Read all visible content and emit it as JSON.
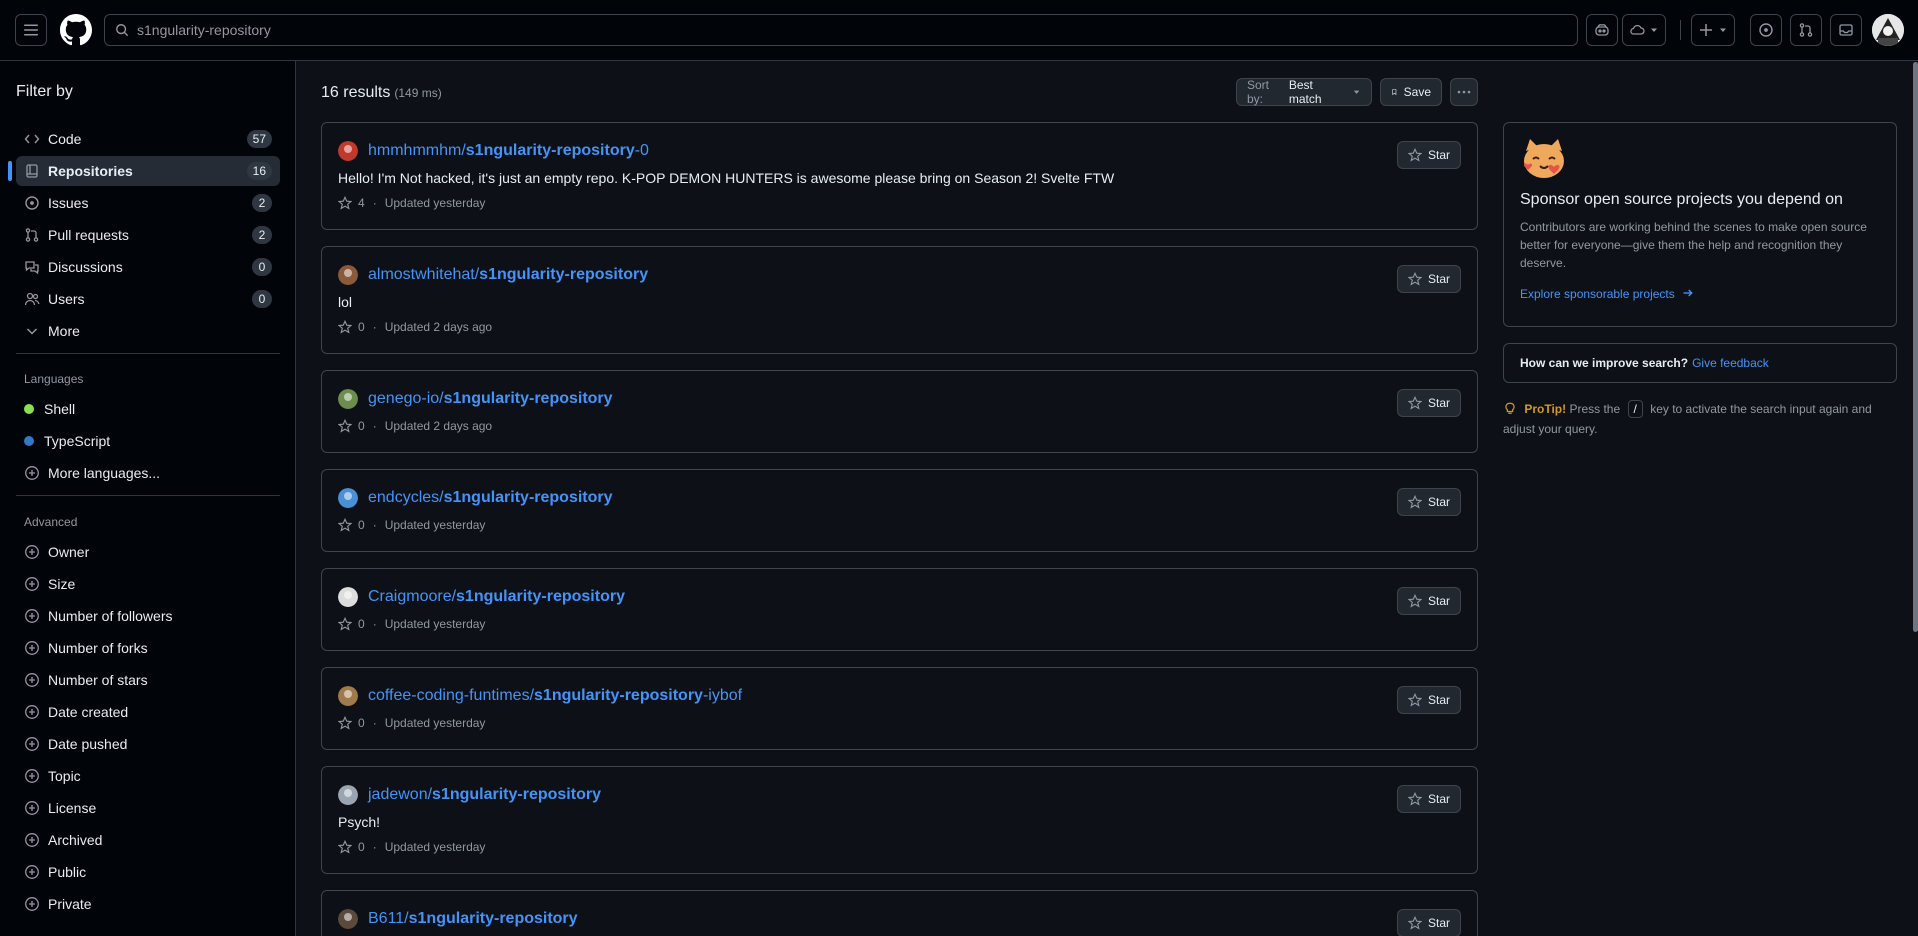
{
  "header": {
    "search_query": "s1ngularity-repository"
  },
  "sidebar": {
    "title": "Filter by",
    "types": [
      {
        "label": "Code",
        "count": "57"
      },
      {
        "label": "Repositories",
        "count": "16"
      },
      {
        "label": "Issues",
        "count": "2"
      },
      {
        "label": "Pull requests",
        "count": "2"
      },
      {
        "label": "Discussions",
        "count": "0"
      },
      {
        "label": "Users",
        "count": "0"
      }
    ],
    "more_label": "More",
    "languages_title": "Languages",
    "languages": [
      {
        "label": "Shell",
        "color": "#89e051"
      },
      {
        "label": "TypeScript",
        "color": "#3178c6"
      }
    ],
    "more_languages_label": "More languages...",
    "advanced_title": "Advanced",
    "advanced": [
      "Owner",
      "Size",
      "Number of followers",
      "Number of forks",
      "Number of stars",
      "Date created",
      "Date pushed",
      "Topic",
      "License",
      "Archived",
      "Public",
      "Private"
    ]
  },
  "main": {
    "results_count": "16 results",
    "results_time": "(149 ms)",
    "sort_prefix": "Sort by:",
    "sort_value": "Best match",
    "save_label": "Save",
    "star_label": "Star",
    "results": [
      {
        "owner": "hmmhmmhm/",
        "name": "s1ngularity-repository",
        "suffix": "-0",
        "description": "Hello! I'm Not hacked, it's just an empty repo. K-POP DEMON HUNTERS is awesome please bring on Season 2! Svelte FTW",
        "stars": "4",
        "updated": "Updated yesterday"
      },
      {
        "owner": "almostwhitehat/",
        "name": "s1ngularity-repository",
        "suffix": "",
        "description": "lol",
        "stars": "0",
        "updated": "Updated 2 days ago"
      },
      {
        "owner": "genego-io/",
        "name": "s1ngularity-repository",
        "suffix": "",
        "description": "",
        "stars": "0",
        "updated": "Updated 2 days ago"
      },
      {
        "owner": "endcycles/",
        "name": "s1ngularity-repository",
        "suffix": "",
        "description": "",
        "stars": "0",
        "updated": "Updated yesterday"
      },
      {
        "owner": "Craigmoore/",
        "name": "s1ngularity-repository",
        "suffix": "",
        "description": "",
        "stars": "0",
        "updated": "Updated yesterday"
      },
      {
        "owner": "coffee-coding-funtimes/",
        "name": "s1ngularity-repository",
        "suffix": "-iybof",
        "description": "",
        "stars": "0",
        "updated": "Updated yesterday"
      },
      {
        "owner": "jadewon/",
        "name": "s1ngularity-repository",
        "suffix": "",
        "description": "Psych!",
        "stars": "0",
        "updated": "Updated yesterday"
      },
      {
        "owner": "B611/",
        "name": "s1ngularity-repository",
        "suffix": "",
        "description": "",
        "stars": "",
        "updated": ""
      }
    ]
  },
  "rail": {
    "sponsor_title": "Sponsor open source projects you depend on",
    "sponsor_text": "Contributors are working behind the scenes to make open source better for everyone—give them the help and recognition they deserve.",
    "sponsor_link": "Explore sponsorable projects",
    "feedback_q": "How can we improve search?",
    "feedback_link": "Give feedback",
    "protip_label": "ProTip!",
    "protip_pre": "Press the",
    "protip_key": "/",
    "protip_post": "key to activate the search input again and adjust your query."
  }
}
